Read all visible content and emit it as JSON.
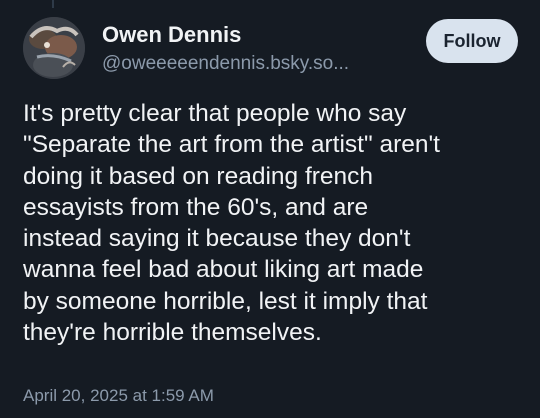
{
  "post": {
    "author": {
      "display_name": "Owen Dennis",
      "handle": "@oweeeeendennis.bsky.so..."
    },
    "follow_label": "Follow",
    "text_lines": [
      "It's pretty clear that people who say",
      "\"Separate the art from the artist\" aren't",
      "doing it based on reading french",
      "essayists from the 60's, and are",
      "instead saying it because they don't",
      "wanna feel bad about liking art made",
      "by someone horrible, lest it imply that",
      "they're horrible themselves."
    ],
    "timestamp": "April 20, 2025 at 1:59 AM"
  },
  "colors": {
    "background": "#151b23",
    "text": "#f1f3f5",
    "muted": "#8c9aab",
    "follow_button_bg": "#d9e3ee"
  },
  "icons": {
    "avatar": "user-avatar-photo"
  }
}
